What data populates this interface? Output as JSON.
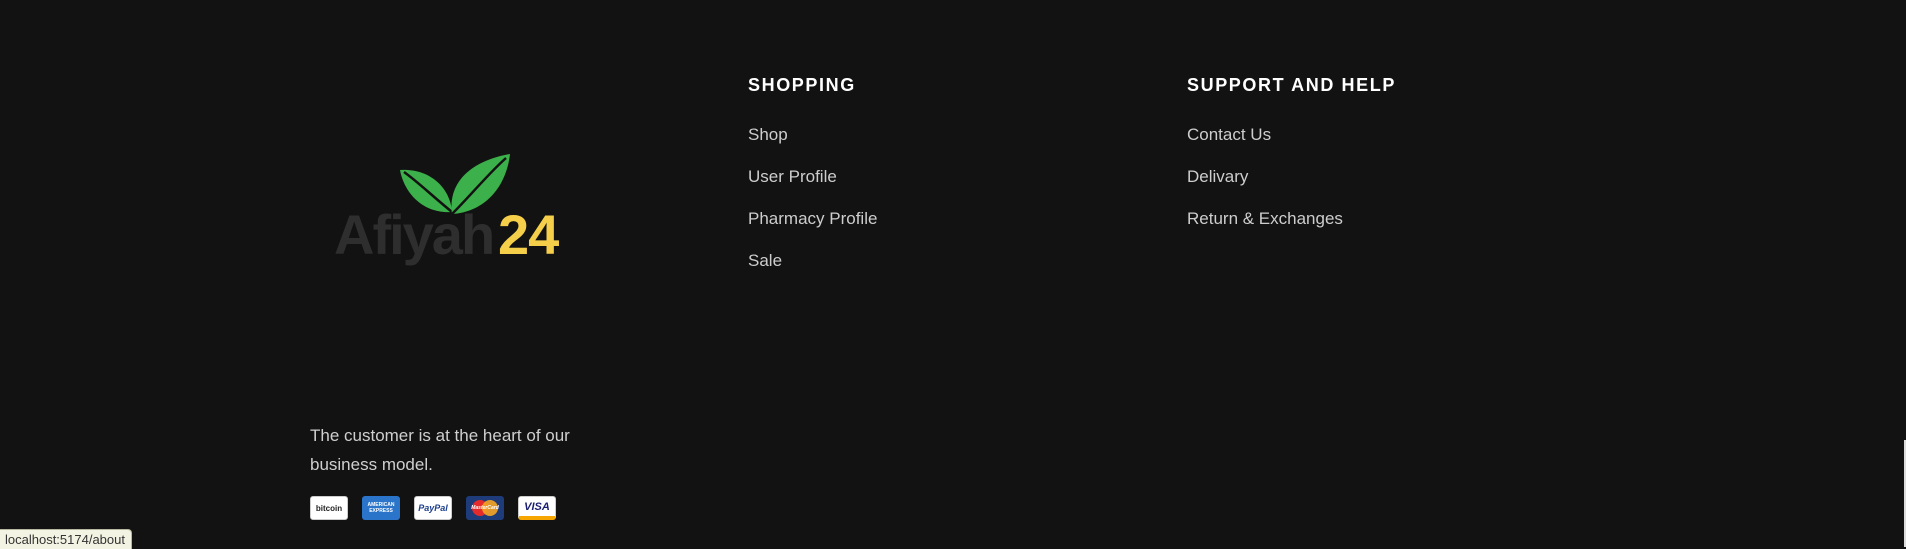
{
  "brand": {
    "logo_wordmark": "Afiyah",
    "logo_number": "24",
    "tagline": "The customer is at the heart of our business model."
  },
  "payments": [
    "bitcoin",
    "AMERICAN EXPRESS",
    "PayPal",
    "MasterCard",
    "VISA"
  ],
  "columns": [
    {
      "title": "SHOPPING",
      "links": [
        "Shop",
        "User Profile",
        "Pharmacy Profile",
        "Sale"
      ]
    },
    {
      "title": "SUPPORT AND HELP",
      "links": [
        "Contact Us",
        "Delivary",
        "Return & Exchanges"
      ]
    }
  ],
  "status_bar": {
    "url": "localhost:5174/about"
  },
  "colors": {
    "background": "#121212",
    "leaf_green": "#3cb04a",
    "logo_gray": "#2e2e2e",
    "logo_yellow": "#f5cf4a"
  }
}
